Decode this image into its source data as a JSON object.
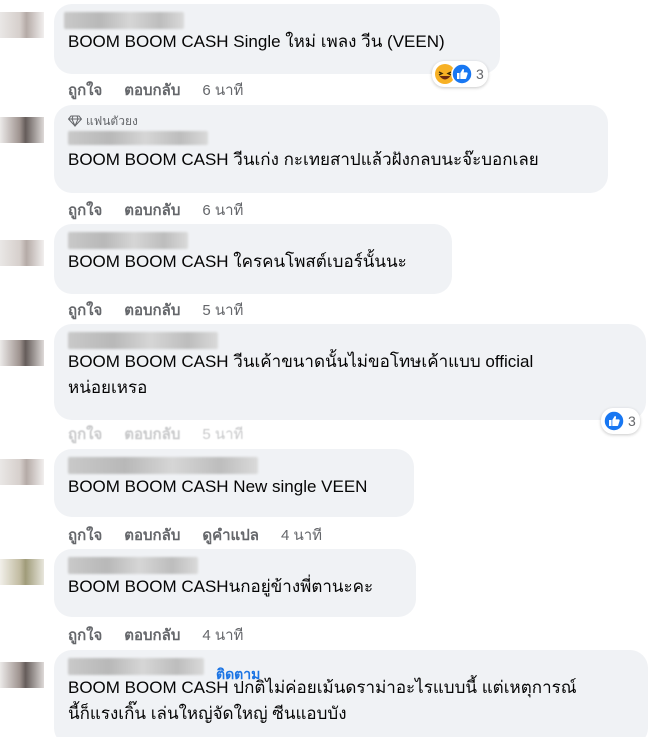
{
  "comments": [
    {
      "text": "BOOM BOOM CASH Single ใหม่ เพลง วีน (VEEN)",
      "like": "ถูกใจ",
      "reply": "ตอบกลับ",
      "time": "6 นาที",
      "reaction_count": "3",
      "reactions": [
        "haha-icon",
        "like-icon"
      ]
    },
    {
      "badge": "แฟนตัวยง",
      "text": "BOOM BOOM CASH วีนเก่ง กะเทยสาปแล้วฝังกลบนะจ๊ะบอกเลย",
      "like": "ถูกใจ",
      "reply": "ตอบกลับ",
      "time": "6 นาที"
    },
    {
      "text": "BOOM BOOM CASH ใครคนโพสต์เบอร์นั้นนะ",
      "like": "ถูกใจ",
      "reply": "ตอบกลับ",
      "time": "5 นาที"
    },
    {
      "text": "BOOM BOOM CASH วีนเค้าขนาดนั้นไม่ขอโทษเค้าแบบ official\nหน่อยเหรอ",
      "like": "ถูกใจ",
      "reply": "ตอบกลับ",
      "time": "5 นาที",
      "reaction_count": "3",
      "reactions": [
        "like-icon"
      ]
    },
    {
      "text": "BOOM BOOM CASH New single VEEN",
      "like": "ถูกใจ",
      "reply": "ตอบกลับ",
      "translate": "ดูคำแปล",
      "time": "4 นาที"
    },
    {
      "text": "BOOM BOOM CASHนกอยู่ข้างพี่ตานะคะ",
      "like": "ถูกใจ",
      "reply": "ตอบกลับ",
      "time": "4 นาที"
    },
    {
      "follow": "ติดตาม",
      "text": "BOOM BOOM CASH ปกติไม่ค่อยเม้นดราม่าอะไรแบบนี้ แต่เหตุการณ์\nนี้ก็แรงเกิ๊น เล่นใหญ่จัดใหญ่ ซีนแอบบัง"
    }
  ],
  "colors": {
    "bubble": "#f0f2f5",
    "meta": "#65676b",
    "link": "#1b74e4",
    "like": "#1877f2",
    "haha": "#f7b125"
  }
}
